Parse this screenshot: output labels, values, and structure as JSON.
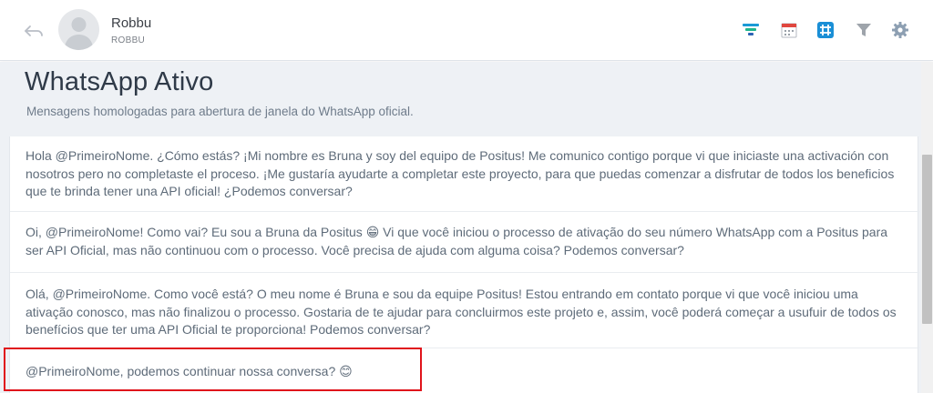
{
  "header": {
    "contact_name": "Robbu",
    "contact_subtitle": "ROBBU",
    "icons": [
      "back-icon",
      "avatar-placeholder",
      "funnel-color-icon",
      "calendar-icon",
      "grid-icon",
      "filter-icon",
      "gear-icon"
    ]
  },
  "page": {
    "title": "WhatsApp Ativo",
    "subtitle": "Mensagens homologadas para abertura de janela do WhatsApp oficial."
  },
  "messages": [
    "Hola @PrimeiroNome. ¿Cómo estás? ¡Mi nombre es Bruna y soy del equipo de Positus! Me comunico contigo porque vi que iniciaste una activación con nosotros pero no completaste el proceso. ¡Me gustaría ayudarte a completar este proyecto, para que puedas comenzar a disfrutar de todos los beneficios que te brinda tener una API oficial! ¿Podemos conversar?",
    "Oi, @PrimeiroNome! Como vai? Eu sou a Bruna da Positus 😁 Vi que você iniciou o processo de ativação do seu número WhatsApp com a Positus para ser API Oficial, mas não continuou com o processo. Você precisa de ajuda com alguma coisa? Podemos conversar?",
    "Olá, @PrimeiroNome. Como você está? O meu nome é Bruna e sou da equipe Positus! Estou entrando em contato porque vi que você iniciou uma ativação conosco, mas não finalizou o processo. Gostaria de te ajudar para concluirmos este projeto e, assim, você poderá começar a usufuir de todos os benefícios que ter uma API Oficial te proporciona! Podemos conversar?",
    "@PrimeiroNome, podemos continuar nossa conversa? 😊"
  ],
  "colors": {
    "highlight": "#e0141b",
    "panel_bg": "#eef1f5",
    "title": "#2f3a48",
    "message_text": "#5e6b79"
  }
}
